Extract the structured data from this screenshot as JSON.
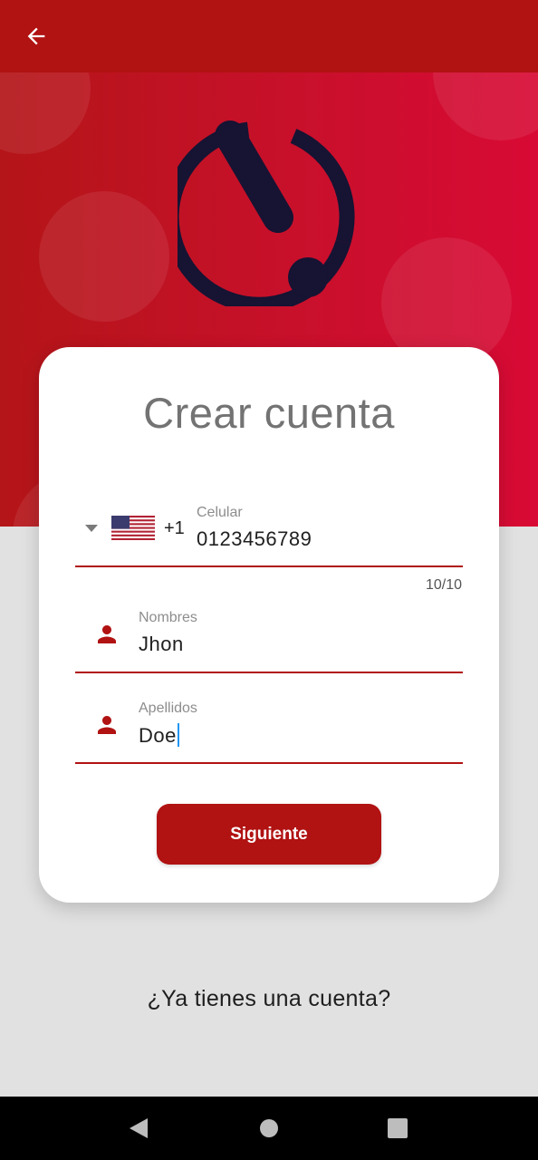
{
  "appbar": {
    "back_icon": "arrow-left-icon"
  },
  "logo": {
    "icon": "exclamation-timer-logo",
    "color": "#161333"
  },
  "card": {
    "title": "Crear cuenta",
    "phone": {
      "country_flag": "us-flag-icon",
      "dial_code": "+1",
      "label": "Celular",
      "value": "0123456789",
      "counter": "10/10"
    },
    "first_name": {
      "label": "Nombres",
      "value": "Jhon",
      "icon": "person-icon"
    },
    "last_name": {
      "label": "Apellidos",
      "value": "Doe",
      "icon": "person-icon"
    },
    "next_button": "Siguiente"
  },
  "login_prompt": "¿Ya tienes una cuenta?",
  "navbar": {
    "back": "nav-back-icon",
    "home": "nav-home-icon",
    "recents": "nav-recents-icon"
  },
  "colors": {
    "primary": "#b11212",
    "accent_gradient_end": "#d80a35",
    "background": "#e1e1e1"
  }
}
